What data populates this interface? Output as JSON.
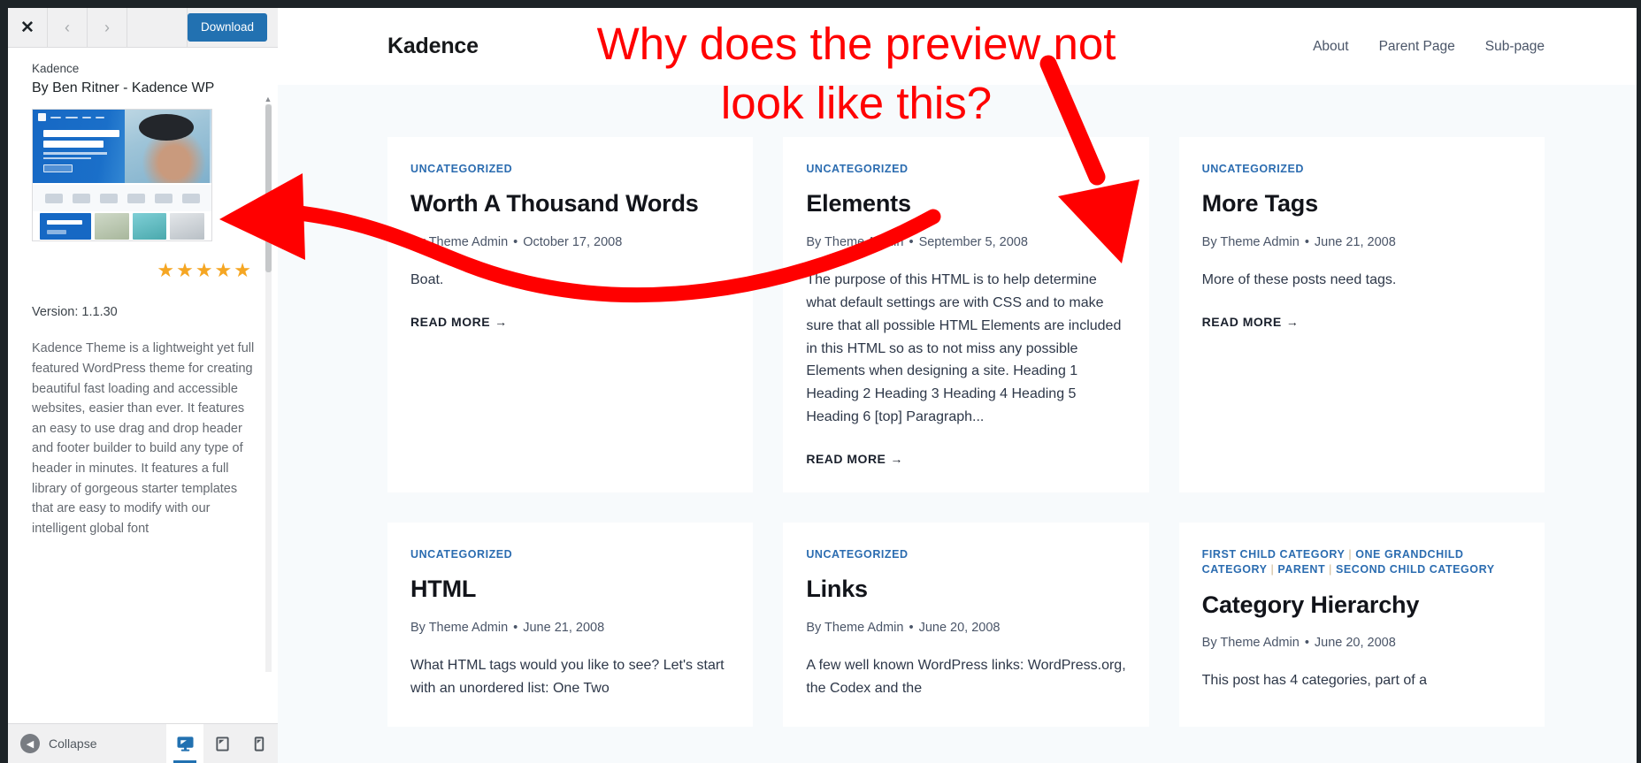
{
  "customizer": {
    "header": {
      "close_icon": "close-icon",
      "prev_icon": "chevron-left-icon",
      "next_icon": "chevron-right-icon",
      "download_label": "Download"
    },
    "theme": {
      "name": "Kadence",
      "author": "By Ben Ritner - Kadence WP",
      "stars": "★★★★★",
      "rating": 5,
      "version_label": "Version: 1.1.30",
      "description": "Kadence Theme is a lightweight yet full featured WordPress theme for creating beautiful fast loading and accessible websites, easier than ever. It features an easy to use drag and drop header and footer builder to build any type of header in minutes. It features a full library of gorgeous starter templates that are easy to modify with our intelligent global font",
      "screenshot": {
        "hero_line1": "YOUR WEBSITE",
        "hero_line2": "YOUR WAY",
        "promo_label": "NEW ARRIVALS"
      }
    },
    "footer": {
      "collapse_label": "Collapse",
      "collapse_icon": "chevron-left-circle-icon",
      "devices": [
        {
          "name": "desktop-icon",
          "active": true
        },
        {
          "name": "tablet-icon",
          "active": false
        },
        {
          "name": "mobile-icon",
          "active": false
        }
      ]
    }
  },
  "preview": {
    "site_title": "Kadence",
    "nav": [
      {
        "label": "About"
      },
      {
        "label": "Parent Page"
      },
      {
        "label": "Sub-page"
      }
    ],
    "read_more_label": "READ MORE",
    "read_more_arrow": "→",
    "posts": [
      {
        "category": "UNCATEGORIZED",
        "title": "Worth A Thousand Words",
        "author": "By Theme Admin",
        "date": "October 17, 2008",
        "excerpt": "Boat.",
        "read_more": "READ MORE"
      },
      {
        "category": "UNCATEGORIZED",
        "title": "Elements",
        "author": "By Theme Admin",
        "date": "September 5, 2008",
        "excerpt": "The purpose of this HTML is to help determine what default settings are with CSS and to make sure that all possible HTML Elements are included in this HTML so as to not miss any possible Elements when designing a site. Heading 1 Heading 2 Heading 3 Heading 4 Heading 5 Heading 6 [top] Paragraph...",
        "read_more": "READ MORE"
      },
      {
        "category": "UNCATEGORIZED",
        "title": "More Tags",
        "author": "By Theme Admin",
        "date": "June 21, 2008",
        "excerpt": "More of these posts need tags.",
        "read_more": "READ MORE"
      },
      {
        "category": "UNCATEGORIZED",
        "title": "HTML",
        "author": "By Theme Admin",
        "date": "June 21, 2008",
        "excerpt": "What HTML tags would you like to see? Let's start with an unordered list: One Two"
      },
      {
        "category": "UNCATEGORIZED",
        "title": "Links",
        "author": "By Theme Admin",
        "date": "June 20, 2008",
        "excerpt": "A few well known WordPress links: WordPress.org, the Codex and the"
      },
      {
        "category": "FIRST CHILD CATEGORY | ONE GRANDCHILD CATEGORY | PARENT | SECOND CHILD CATEGORY",
        "title": "Category Hierarchy",
        "author": "By Theme Admin",
        "date": "June 20, 2008",
        "excerpt": "This post has 4 categories, part of a"
      }
    ]
  },
  "annotation": {
    "text": "Why does the preview not look like this?",
    "color": "#ff0000",
    "arrows": [
      {
        "name": "curved-arrow-to-theme-screenshot",
        "direction": "left"
      },
      {
        "name": "straight-arrow-to-preview-cards",
        "direction": "down-right"
      }
    ]
  }
}
